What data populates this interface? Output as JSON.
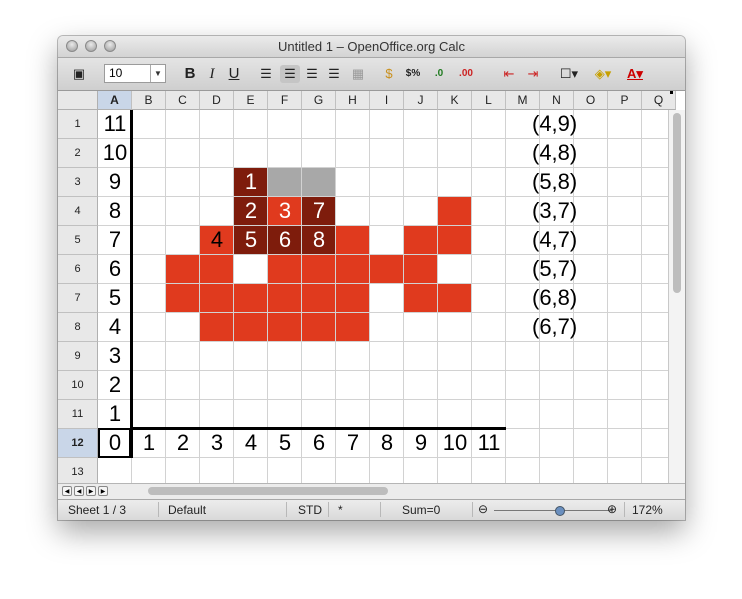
{
  "window": {
    "title": "Untitled 1 – OpenOffice.org Calc"
  },
  "toolbar": {
    "font_size": "10",
    "bold": "B",
    "italic": "I",
    "underline": "U",
    "currency": "$%",
    "decimal_add": ".0",
    "decimal_remove": ".00"
  },
  "columns": [
    "A",
    "B",
    "C",
    "D",
    "E",
    "F",
    "G",
    "H",
    "I",
    "J",
    "K",
    "L",
    "M",
    "N",
    "O",
    "P",
    "Q"
  ],
  "rows": [
    "1",
    "2",
    "3",
    "4",
    "5",
    "6",
    "7",
    "8",
    "9",
    "10",
    "11",
    "12",
    "13"
  ],
  "selected_cell": "A12",
  "y_axis_labels": [
    "11",
    "10",
    "9",
    "8",
    "7",
    "6",
    "5",
    "4",
    "3",
    "2",
    "1",
    "0"
  ],
  "x_axis_labels": [
    "1",
    "2",
    "3",
    "4",
    "5",
    "6",
    "7",
    "8",
    "9",
    "10",
    "11"
  ],
  "coordinates": [
    "(4,9)",
    "(4,8)",
    "(5,8)",
    "(3,7)",
    "(4,7)",
    "(5,7)",
    "(6,8)",
    "(6,7)"
  ],
  "numbered_cells": [
    {
      "label": "1",
      "col": "E",
      "row": "3"
    },
    {
      "label": "2",
      "col": "E",
      "row": "4"
    },
    {
      "label": "3",
      "col": "F",
      "row": "4"
    },
    {
      "label": "7",
      "col": "G",
      "row": "4"
    },
    {
      "label": "4",
      "col": "D",
      "row": "5"
    },
    {
      "label": "5",
      "col": "E",
      "row": "5"
    },
    {
      "label": "6",
      "col": "F",
      "row": "5"
    },
    {
      "label": "8",
      "col": "G",
      "row": "5"
    }
  ],
  "colors": {
    "red": "#e03a1e",
    "dark_red": "#7e1c0c",
    "gray": "#a8a8a8"
  },
  "status": {
    "sheet": "Sheet 1 / 3",
    "style": "Default",
    "mode": "STD",
    "modified": "*",
    "sum": "Sum=0",
    "zoom": "172%"
  }
}
